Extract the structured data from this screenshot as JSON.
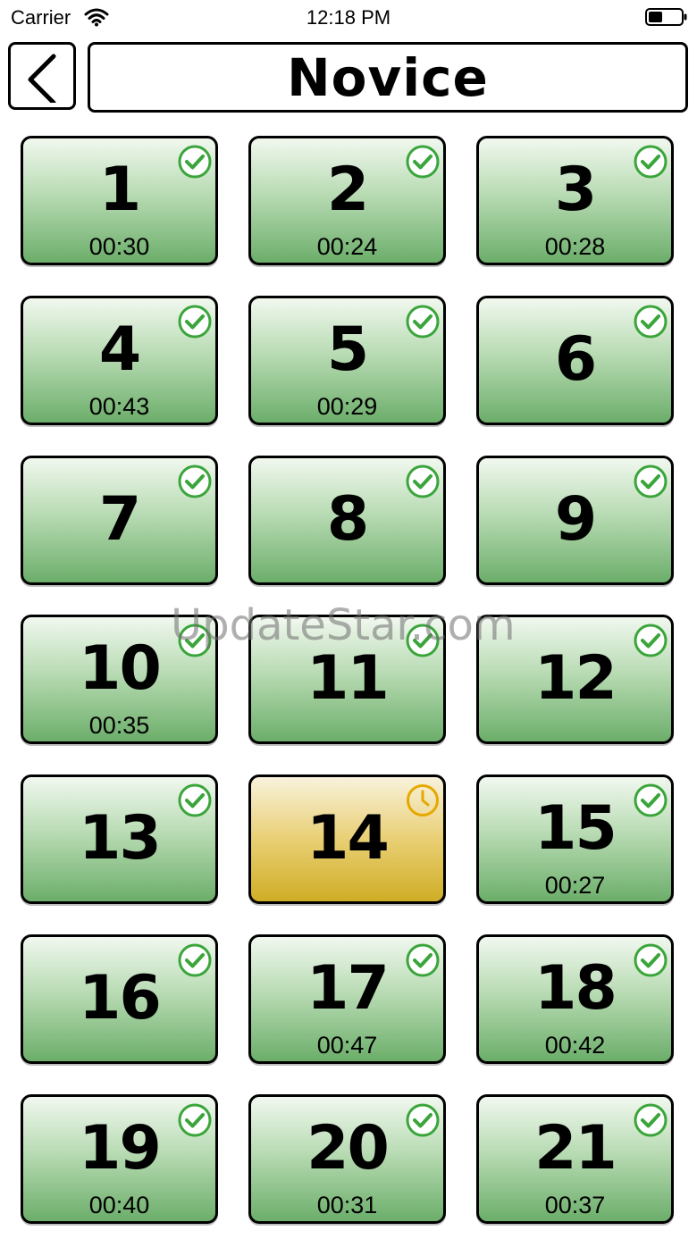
{
  "status_bar": {
    "carrier": "Carrier",
    "time": "12:18 PM",
    "wifi_icon": "wifi-icon",
    "battery_icon": "battery-icon"
  },
  "header": {
    "title": "Novice",
    "back_icon": "chevron-left-icon"
  },
  "colors": {
    "completed_top": "#f1f8ef",
    "completed_bottom": "#6cae6a",
    "completed_check": "#3aa53a",
    "pending_top": "#f8f2dc",
    "pending_bottom": "#cfae25",
    "pending_clock": "#e6a800"
  },
  "levels": [
    {
      "number": "1",
      "time": "00:30",
      "status": "completed"
    },
    {
      "number": "2",
      "time": "00:24",
      "status": "completed"
    },
    {
      "number": "3",
      "time": "00:28",
      "status": "completed"
    },
    {
      "number": "4",
      "time": "00:43",
      "status": "completed"
    },
    {
      "number": "5",
      "time": "00:29",
      "status": "completed"
    },
    {
      "number": "6",
      "time": "",
      "status": "completed"
    },
    {
      "number": "7",
      "time": "",
      "status": "completed"
    },
    {
      "number": "8",
      "time": "",
      "status": "completed"
    },
    {
      "number": "9",
      "time": "",
      "status": "completed"
    },
    {
      "number": "10",
      "time": "00:35",
      "status": "completed"
    },
    {
      "number": "11",
      "time": "",
      "status": "completed"
    },
    {
      "number": "12",
      "time": "",
      "status": "completed"
    },
    {
      "number": "13",
      "time": "",
      "status": "completed"
    },
    {
      "number": "14",
      "time": "",
      "status": "pending"
    },
    {
      "number": "15",
      "time": "00:27",
      "status": "completed"
    },
    {
      "number": "16",
      "time": "",
      "status": "completed"
    },
    {
      "number": "17",
      "time": "00:47",
      "status": "completed"
    },
    {
      "number": "18",
      "time": "00:42",
      "status": "completed"
    },
    {
      "number": "19",
      "time": "00:40",
      "status": "completed"
    },
    {
      "number": "20",
      "time": "00:31",
      "status": "completed"
    },
    {
      "number": "21",
      "time": "00:37",
      "status": "completed"
    }
  ],
  "watermark": "UpdateStar.com"
}
